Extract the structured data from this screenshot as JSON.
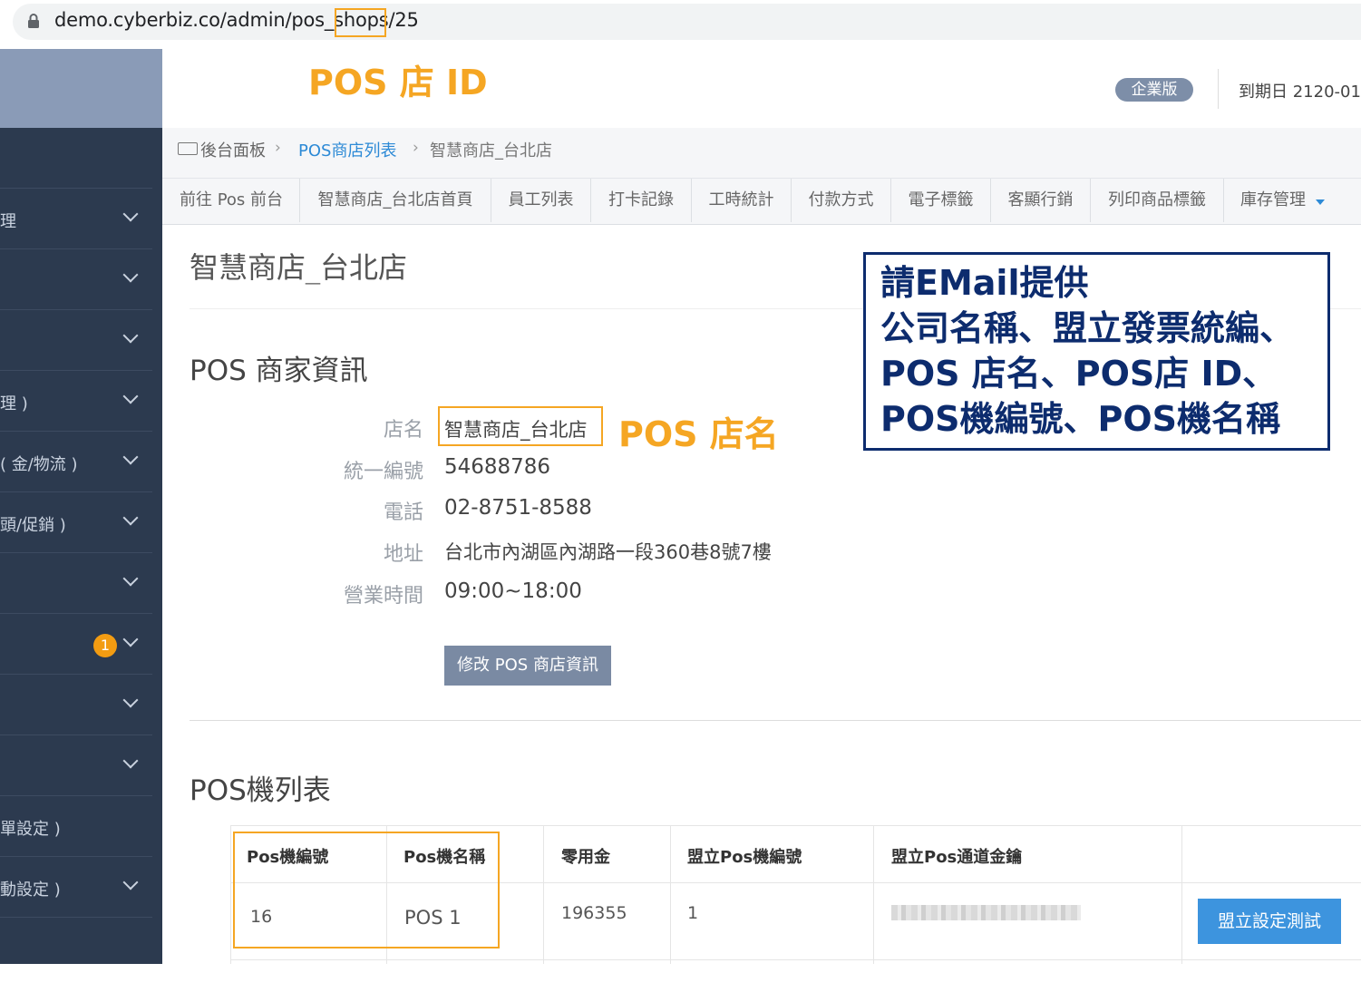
{
  "browser": {
    "url": "demo.cyberbiz.co/admin/pos_shops/25"
  },
  "annotations": {
    "pos_id": "POS 店 ID",
    "pos_name": "POS 店名",
    "note_lines": [
      "請EMail提供",
      "公司名稱、盟立發票統編、",
      "POS 店名、POS店 ID、",
      "POS機編號、POS機名稱"
    ],
    "highlight_color": "#f5a623",
    "note_color": "#0d2c6e"
  },
  "header": {
    "plan_badge": "企業版",
    "expiry": "到期日 2120-01"
  },
  "sidebar": {
    "items": [
      {
        "label": ""
      },
      {
        "label": "理"
      },
      {
        "label": ""
      },
      {
        "label": ""
      },
      {
        "label": "理 )"
      },
      {
        "label": "( 金/物流 )"
      },
      {
        "label": "頭/促銷 )"
      },
      {
        "label": ""
      },
      {
        "label": "",
        "badge": "1"
      },
      {
        "label": ""
      },
      {
        "label": ""
      },
      {
        "label": "單設定 )"
      },
      {
        "label": "動設定 )"
      }
    ]
  },
  "breadcrumb": {
    "home": "後台面板",
    "list": "POS商店列表",
    "current": "智慧商店_台北店"
  },
  "tabs": [
    "前往 Pos 前台",
    "智慧商店_台北店首頁",
    "員工列表",
    "打卡記錄",
    "工時統計",
    "付款方式",
    "電子標籤",
    "客顯行銷",
    "列印商品標籤",
    "庫存管理"
  ],
  "page": {
    "title": "智慧商店_台北店",
    "info_section": "POS 商家資訊",
    "fields": {
      "name_label": "店名",
      "name": "智慧商店_台北店",
      "tax_label": "統一編號",
      "tax_id": "54688786",
      "phone_label": "電話",
      "phone": "02-8751-8588",
      "address_label": "地址",
      "address": "台北市內湖區內湖路一段360巷8號7樓",
      "hours_label": "營業時間",
      "hours": "09:00~18:00"
    },
    "edit_button": "修改 POS 商店資訊",
    "list_section": "POS機列表"
  },
  "machine_table": {
    "headers": [
      "Pos機編號",
      "Pos機名稱",
      "零用金",
      "盟立Pos機編號",
      "盟立Pos通道金鑰"
    ],
    "row": {
      "id": "16",
      "name": "POS 1",
      "petty_cash": "196355",
      "ml_id": "1"
    },
    "test_button": "盟立設定測試"
  }
}
